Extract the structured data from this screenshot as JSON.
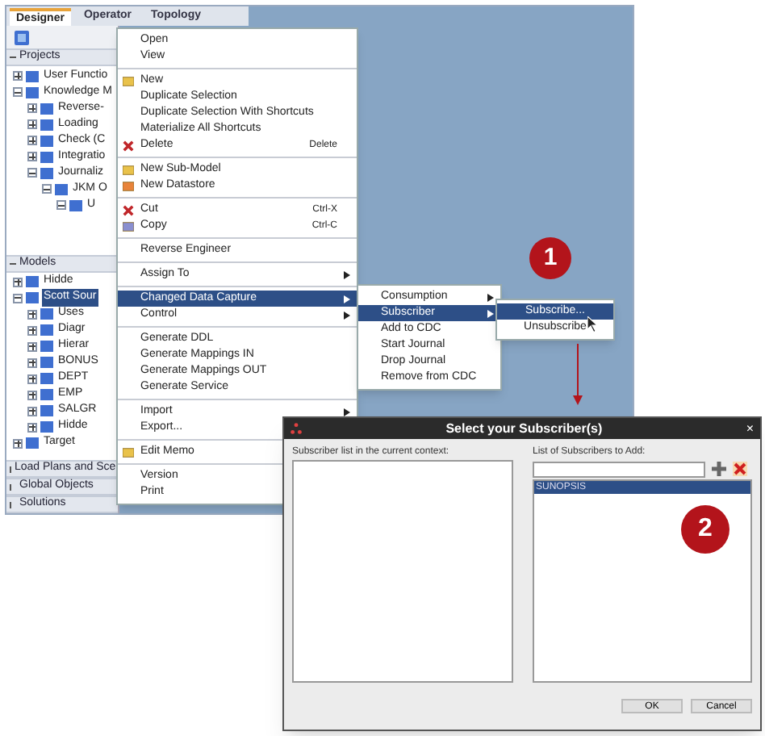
{
  "tabs": [
    {
      "label": "Designer",
      "selected": true
    },
    {
      "label": "Operator",
      "selected": false
    },
    {
      "label": "Topology",
      "selected": false
    }
  ],
  "sections": [
    {
      "title": "Projects",
      "expanded": true,
      "tree": [
        {
          "label": "User Functio",
          "expanded": false
        },
        {
          "label": "Knowledge M",
          "expanded": true,
          "children": [
            {
              "label": "Reverse-",
              "expanded": false
            },
            {
              "label": "Loading",
              "expanded": false
            },
            {
              "label": "Check (C",
              "expanded": false
            },
            {
              "label": "Integratio",
              "expanded": false
            },
            {
              "label": "Journaliz",
              "expanded": true,
              "children": [
                {
                  "label": "JKM O",
                  "expanded": true,
                  "children": [
                    {
                      "label": "U",
                      "expanded": true
                    }
                  ]
                }
              ]
            }
          ]
        }
      ]
    },
    {
      "title": "Models",
      "expanded": true,
      "tree": [
        {
          "label": "Hidde",
          "expanded": false
        },
        {
          "label": "Scott Sour",
          "expanded": true,
          "selected": true,
          "children": [
            {
              "label": "Uses",
              "expanded": false
            },
            {
              "label": "Diagr",
              "expanded": false
            },
            {
              "label": "Hierar",
              "expanded": false
            },
            {
              "label": "BONUS",
              "expanded": false
            },
            {
              "label": "DEPT",
              "expanded": false
            },
            {
              "label": "EMP",
              "expanded": false
            },
            {
              "label": "SALGR",
              "expanded": false
            },
            {
              "label": "Hidde",
              "expanded": false
            }
          ]
        },
        {
          "label": "Target",
          "expanded": false
        }
      ]
    },
    {
      "title": "Load Plans and Sce",
      "expanded": false
    },
    {
      "title": "Global Objects",
      "expanded": false
    },
    {
      "title": "Solutions",
      "expanded": false
    }
  ],
  "context_menu": [
    {
      "kind": "item",
      "label": "Open"
    },
    {
      "kind": "item",
      "label": "View"
    },
    {
      "kind": "separator"
    },
    {
      "kind": "item",
      "label": "New"
    },
    {
      "kind": "item",
      "label": "Duplicate Selection"
    },
    {
      "kind": "item",
      "label": "Duplicate Selection With Shortcuts"
    },
    {
      "kind": "item",
      "label": "Materialize All Shortcuts"
    },
    {
      "kind": "item",
      "label": "Delete",
      "shortcut": "Delete"
    },
    {
      "kind": "separator"
    },
    {
      "kind": "item",
      "label": "New Sub-Model"
    },
    {
      "kind": "item",
      "label": "New Datastore"
    },
    {
      "kind": "separator"
    },
    {
      "kind": "item",
      "label": "Cut",
      "shortcut": "Ctrl-X"
    },
    {
      "kind": "item",
      "label": "Copy",
      "shortcut": "Ctrl-C"
    },
    {
      "kind": "separator"
    },
    {
      "kind": "item",
      "label": "Reverse Engineer"
    },
    {
      "kind": "separator"
    },
    {
      "kind": "item",
      "label": "Assign To",
      "submenu": true
    },
    {
      "kind": "separator"
    },
    {
      "kind": "item",
      "label": "Changed Data Capture",
      "submenu": true,
      "selected": true
    },
    {
      "kind": "item",
      "label": "Control",
      "submenu": true
    },
    {
      "kind": "separator"
    },
    {
      "kind": "item",
      "label": "Generate DDL"
    },
    {
      "kind": "item",
      "label": "Generate Mappings IN"
    },
    {
      "kind": "item",
      "label": "Generate Mappings OUT"
    },
    {
      "kind": "item",
      "label": "Generate Service"
    },
    {
      "kind": "separator"
    },
    {
      "kind": "item",
      "label": "Import",
      "submenu": true
    },
    {
      "kind": "item",
      "label": "Export..."
    },
    {
      "kind": "separator"
    },
    {
      "kind": "item",
      "label": "Edit Memo"
    },
    {
      "kind": "separator"
    },
    {
      "kind": "item",
      "label": "Version"
    },
    {
      "kind": "item",
      "label": "Print"
    }
  ],
  "cdc_menu": [
    {
      "label": "Consumption",
      "submenu": true,
      "selected": false
    },
    {
      "label": "Subscriber",
      "submenu": true,
      "selected": true
    },
    {
      "label": "Add to CDC",
      "selected": false
    },
    {
      "label": "Start Journal",
      "selected": false
    },
    {
      "label": "Drop Journal",
      "selected": false
    },
    {
      "label": "Remove from CDC",
      "selected": false
    }
  ],
  "subscriber_menu": [
    {
      "label": "Subscribe...",
      "selected": true
    },
    {
      "label": "Unsubscribe",
      "selected": false
    }
  ],
  "callouts": [
    "1",
    "2"
  ],
  "dialog": {
    "title": "Select your Subscriber(s)",
    "close": "×",
    "left_label": "Subscriber list in the current context:",
    "right_label": "List of Subscribers to Add:",
    "subscribers": [
      {
        "name": "SUNOPSIS",
        "selected": true
      }
    ],
    "buttons": [
      "OK",
      "Cancel"
    ]
  }
}
